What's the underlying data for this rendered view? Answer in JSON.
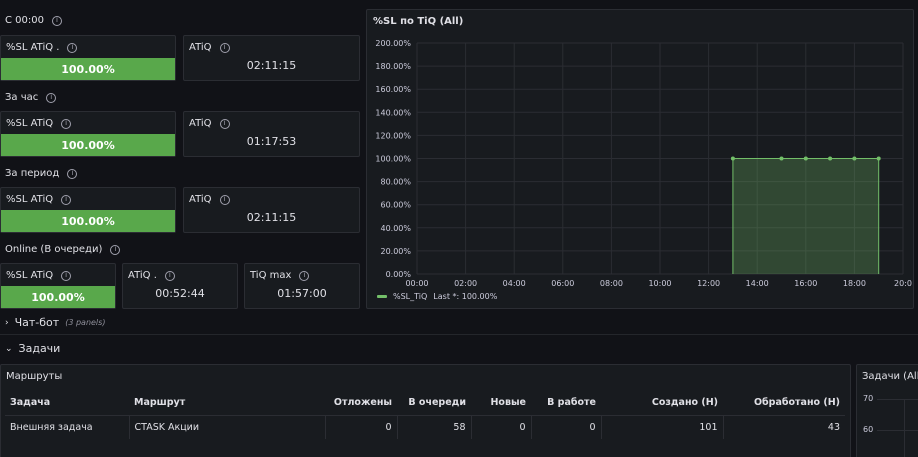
{
  "sections": {
    "since_midnight": "С 00:00",
    "per_hour": "За час",
    "per_period": "За период",
    "online": "Online (В очереди)"
  },
  "stats": {
    "s1_sl_title": "%SL ATiQ .",
    "s1_sl_value": "100.00%",
    "s1_atiq_title": "ATiQ",
    "s1_atiq_value": "02:11:15",
    "s2_sl_title": "%SL ATiQ",
    "s2_sl_value": "100.00%",
    "s2_atiq_title": "ATiQ",
    "s2_atiq_value": "01:17:53",
    "s3_sl_title": "%SL ATiQ",
    "s3_sl_value": "100.00%",
    "s3_atiq_title": "ATiQ",
    "s3_atiq_value": "02:11:15",
    "s4_sl_title": "%SL ATiQ",
    "s4_sl_value": "100.00%",
    "s4_atiq_title": "ATiQ .",
    "s4_atiq_value": "00:52:44",
    "s4_tiqmax_title": "TiQ max",
    "s4_tiqmax_value": "01:57:00",
    "gauge_fill": 1.0,
    "gauge_color": "#59a84b"
  },
  "chart_panel_title": "%SL по TiQ (All)",
  "chart_data": {
    "type": "area",
    "y_ticks": [
      "200.00%",
      "180.00%",
      "160.00%",
      "140.00%",
      "120.00%",
      "100.00%",
      "80.00%",
      "60.00%",
      "40.00%",
      "20.00%",
      "0.00%"
    ],
    "x_ticks": [
      "00:00",
      "02:00",
      "04:00",
      "06:00",
      "08:00",
      "10:00",
      "12:00",
      "14:00",
      "16:00",
      "18:00",
      "20:0"
    ],
    "ylim": [
      0,
      200
    ],
    "xlim": [
      0,
      20
    ],
    "series": [
      {
        "name": "%SL_TiQ",
        "color": "#73bf69",
        "points": [
          {
            "x": 13,
            "y": 100
          },
          {
            "x": 15,
            "y": 100
          },
          {
            "x": 16,
            "y": 100
          },
          {
            "x": 17,
            "y": 100
          },
          {
            "x": 18,
            "y": 100
          },
          {
            "x": 19,
            "y": 100
          }
        ]
      }
    ],
    "legend_series": "%SL_TiQ",
    "legend_last": "Last *: 100.00%",
    "legend_placement": "bottom-left",
    "grid": true
  },
  "rows": {
    "chatbot_label": "Чат-бот",
    "chatbot_count": "(3 panels)",
    "tasks_label": "Задачи"
  },
  "routes_panel": {
    "title": "Маршруты",
    "columns": [
      "Задача",
      "Маршрут",
      "Отложены",
      "В очереди",
      "Новые",
      "В работе",
      "Создано (Н)",
      "Обработано (Н)"
    ],
    "rows": [
      [
        "Внешняя задача",
        "CTASK Акции",
        "0",
        "58",
        "0",
        "0",
        "101",
        "43"
      ]
    ]
  },
  "tasks_panel": {
    "title": "Задачи (All)",
    "y_ticks": [
      "70",
      "60"
    ]
  }
}
